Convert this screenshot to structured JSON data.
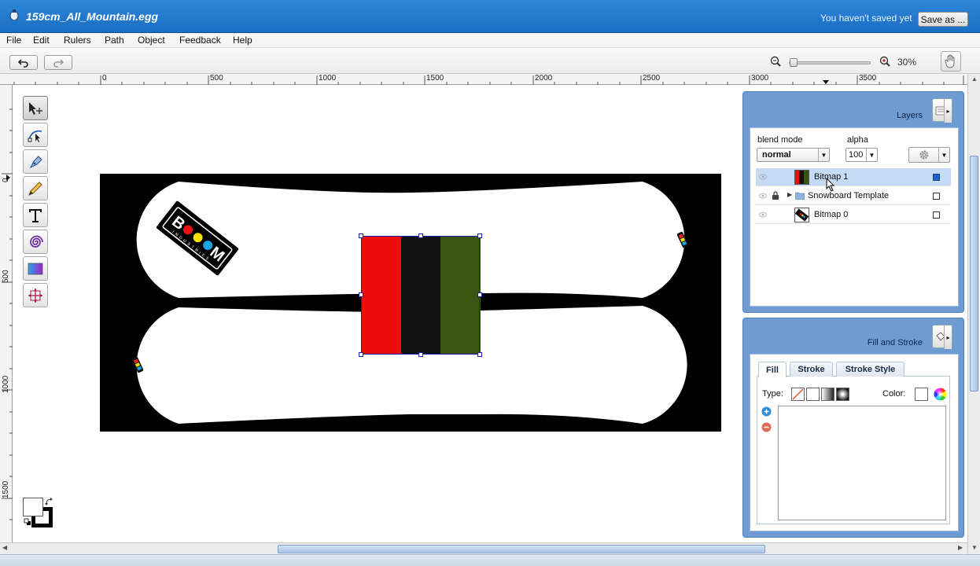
{
  "window": {
    "title": "159cm_All_Mountain.egg",
    "save_status": "You haven't saved yet",
    "save_as_label": "Save as ..."
  },
  "menu": [
    "File",
    "Edit",
    "Rulers",
    "Path",
    "Object",
    "Feedback",
    "Help"
  ],
  "toolbar": {
    "zoom_label": "30%",
    "zoom_level": 0.3
  },
  "ruler": {
    "x_labels": [
      "0",
      "500",
      "1000",
      "1500",
      "2000",
      "2500",
      "3000",
      "3500"
    ],
    "y_labels": [
      "0",
      "500",
      "1000",
      "1500"
    ]
  },
  "tools": [
    "selection-tool-icon",
    "node-edit-tool-icon",
    "pen-tool-icon",
    "pencil-tool-icon",
    "text-tool-icon",
    "spiral-tool-icon",
    "gradient-tool-icon",
    "transform-tool-icon"
  ],
  "layers_panel": {
    "title": "Layers",
    "blend_mode_label": "blend mode",
    "blend_mode_value": "normal",
    "alpha_label": "alpha",
    "alpha_value": "100",
    "layers": [
      {
        "name": "Bitmap 1",
        "selected": true,
        "locked": false,
        "folder": false
      },
      {
        "name": "Snowboard Template",
        "selected": false,
        "locked": true,
        "folder": true
      },
      {
        "name": "Bitmap 0",
        "selected": false,
        "locked": false,
        "folder": false
      }
    ]
  },
  "fill_panel": {
    "title": "Fill and Stroke",
    "tabs": [
      "Fill",
      "Stroke",
      "Stroke Style"
    ],
    "type_label": "Type:",
    "color_label": "Color:"
  },
  "artwork": {
    "logo_letters": "BOOM",
    "logo_sub": "INDUSTRIES",
    "stripe_colors": [
      "#ee0d0d",
      "#111111",
      "#3a5412"
    ],
    "board_color": "#ffffff",
    "background_color": "#000000"
  }
}
